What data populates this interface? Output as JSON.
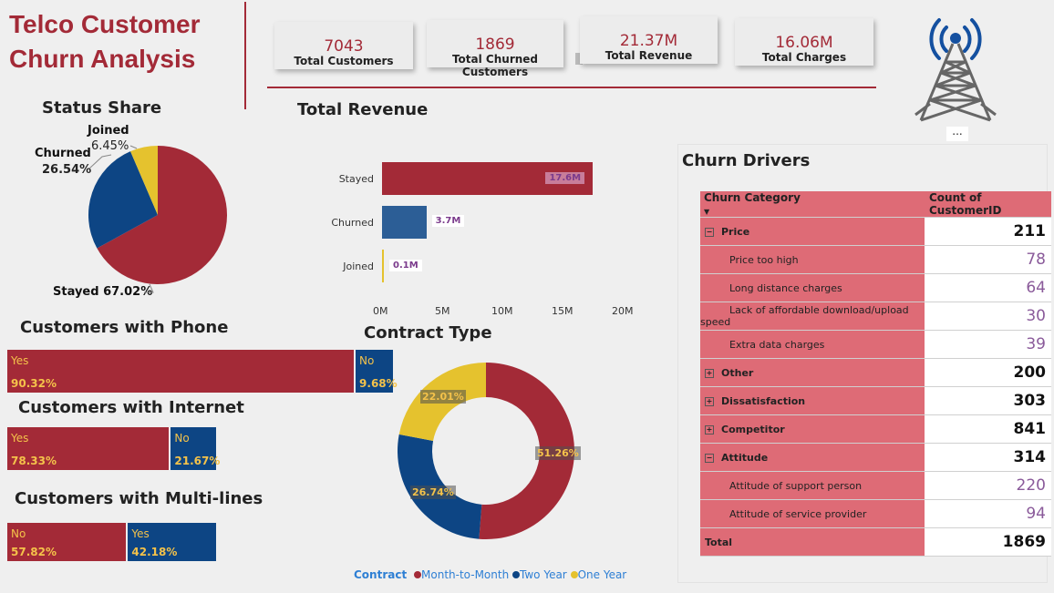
{
  "header": {
    "title_line1": "Telco Customer",
    "title_line2": "Churn Analysis"
  },
  "kpis": [
    {
      "value": "7043",
      "label": "Total Customers"
    },
    {
      "value": "1869",
      "label": "Total Churned Customers"
    },
    {
      "value": "21.37M",
      "label": "Total Revenue"
    },
    {
      "value": "16.06M",
      "label": "Total Charges"
    }
  ],
  "icons": {
    "tower": "radio-tower-icon",
    "more": "more-options-icon"
  },
  "more_label": "...",
  "colors": {
    "stayed": "#a32a37",
    "churned": "#0d4584",
    "joined": "#e5c22e",
    "accent": "#a32a37",
    "revenue_churned": "#2c5e96"
  },
  "chart_data": [
    {
      "id": "status_share",
      "type": "pie",
      "title": "Status Share",
      "categories": [
        "Stayed",
        "Churned",
        "Joined"
      ],
      "values": [
        67.02,
        26.54,
        6.45
      ],
      "labels": [
        "Stayed 67.02%",
        "Churned",
        "26.54%",
        "Joined",
        "6.45%"
      ]
    },
    {
      "id": "total_revenue",
      "type": "bar",
      "orientation": "horizontal",
      "title": "Total Revenue",
      "categories": [
        "Stayed",
        "Churned",
        "Joined"
      ],
      "values": [
        17.6,
        3.7,
        0.1
      ],
      "data_labels": [
        "17.6M",
        "3.7M",
        "0.1M"
      ],
      "xlim": [
        0,
        20
      ],
      "x_ticks": [
        "0M",
        "5M",
        "10M",
        "15M",
        "20M"
      ]
    },
    {
      "id": "phone",
      "type": "bar",
      "stacked": true,
      "title": "Customers with Phone",
      "categories": [
        "Yes",
        "No"
      ],
      "values": [
        90.32,
        9.68
      ],
      "labels": [
        "90.32%",
        "9.68%"
      ]
    },
    {
      "id": "internet",
      "type": "bar",
      "stacked": true,
      "title": "Customers with Internet",
      "categories": [
        "Yes",
        "No"
      ],
      "values": [
        78.33,
        21.67
      ],
      "labels": [
        "78.33%",
        "21.67%"
      ]
    },
    {
      "id": "multilines",
      "type": "bar",
      "stacked": true,
      "title": "Customers with Multi-lines",
      "categories": [
        "No",
        "Yes"
      ],
      "values": [
        57.82,
        42.18
      ],
      "labels": [
        "57.82%",
        "42.18%"
      ]
    },
    {
      "id": "contract",
      "type": "pie",
      "donut": true,
      "title": "Contract Type",
      "categories": [
        "Month-to-Month",
        "Two Year",
        "One Year"
      ],
      "values": [
        51.26,
        26.74,
        22.01
      ],
      "labels": [
        "51.26%",
        "26.74%",
        "22.01%"
      ],
      "legend_title": "Contract",
      "legend_position": "bottom"
    },
    {
      "id": "churn_drivers",
      "type": "table",
      "title": "Churn Drivers",
      "columns": [
        "Churn Category",
        "Count of CustomerID"
      ],
      "rows": [
        {
          "label": "Price",
          "count": "211",
          "level": 0,
          "state": "expanded"
        },
        {
          "label": "Price too high",
          "count": "78",
          "level": 1
        },
        {
          "label": "Long distance charges",
          "count": "64",
          "level": 1
        },
        {
          "label": "Lack of affordable download/upload speed",
          "count": "30",
          "level": 1
        },
        {
          "label": "Extra data charges",
          "count": "39",
          "level": 1
        },
        {
          "label": "Other",
          "count": "200",
          "level": 0,
          "state": "collapsed"
        },
        {
          "label": "Dissatisfaction",
          "count": "303",
          "level": 0,
          "state": "collapsed"
        },
        {
          "label": "Competitor",
          "count": "841",
          "level": 0,
          "state": "collapsed"
        },
        {
          "label": "Attitude",
          "count": "314",
          "level": 0,
          "state": "expanded"
        },
        {
          "label": "Attitude of support person",
          "count": "220",
          "level": 1
        },
        {
          "label": "Attitude of service provider",
          "count": "94",
          "level": 1
        },
        {
          "label": "Total",
          "count": "1869",
          "level": 0,
          "total": true
        }
      ]
    }
  ]
}
